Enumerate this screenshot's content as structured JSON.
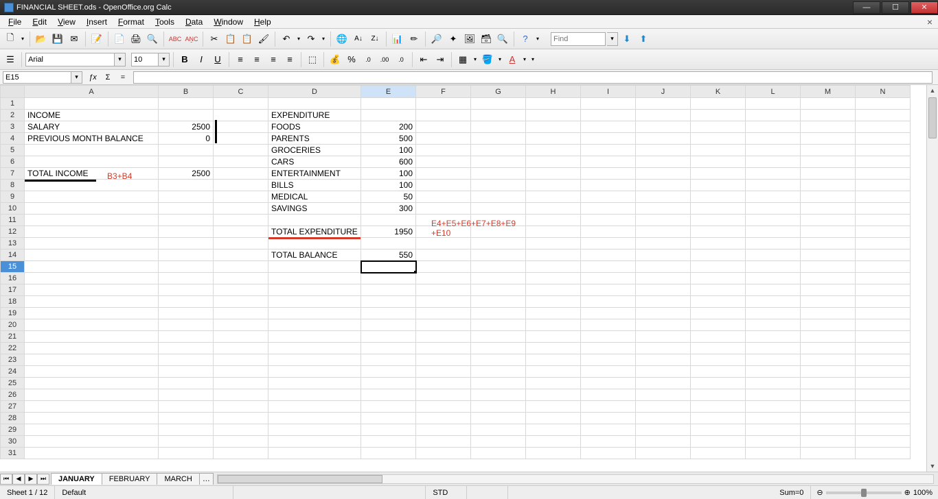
{
  "title": "FINANCIAL SHEET.ods - OpenOffice.org Calc",
  "menus": [
    "File",
    "Edit",
    "View",
    "Insert",
    "Format",
    "Tools",
    "Data",
    "Window",
    "Help"
  ],
  "find_placeholder": "Find",
  "font_name": "Arial",
  "font_size": "10",
  "cell_ref": "E15",
  "formula_value": "",
  "columns": [
    "A",
    "B",
    "C",
    "D",
    "E",
    "F",
    "G",
    "H",
    "I",
    "J",
    "K",
    "L",
    "M",
    "N"
  ],
  "active_col": "E",
  "active_row": 15,
  "row_count": 31,
  "cells": {
    "A2": "INCOME",
    "A3": "   SALARY",
    "A4": "   PREVIOUS MONTH BALANCE",
    "A7": "TOTAL INCOME",
    "B3": "2500",
    "B4": "0",
    "B7": "2500",
    "D2": "EXPENDITURE",
    "D3": "FOODS",
    "D4": "PARENTS",
    "D5": "GROCERIES",
    "D6": "CARS",
    "D7": "ENTERTAINMENT",
    "D8": "BILLS",
    "D9": "MEDICAL",
    "D10": "SAVINGS",
    "D12": "TOTAL EXPENDITURE",
    "D14": "TOTAL BALANCE",
    "E3": "200",
    "E4": "500",
    "E5": "100",
    "E6": "600",
    "E7": "100",
    "E8": "100",
    "E9": "50",
    "E10": "300",
    "E12": "1950",
    "E14": "550"
  },
  "numeric_cols": [
    "B",
    "E"
  ],
  "annotations": {
    "b3b4": "B3+B4",
    "esum": "E4+E5+E6+E7+E8+E9\n+E10"
  },
  "sheet_tabs": [
    "JANUARY",
    "FEBRUARY",
    "MARCH"
  ],
  "active_tab": 0,
  "status": {
    "sheet": "Sheet 1 / 12",
    "style": "Default",
    "insert": "STD",
    "sum": "Sum=0",
    "zoom": "100%"
  }
}
